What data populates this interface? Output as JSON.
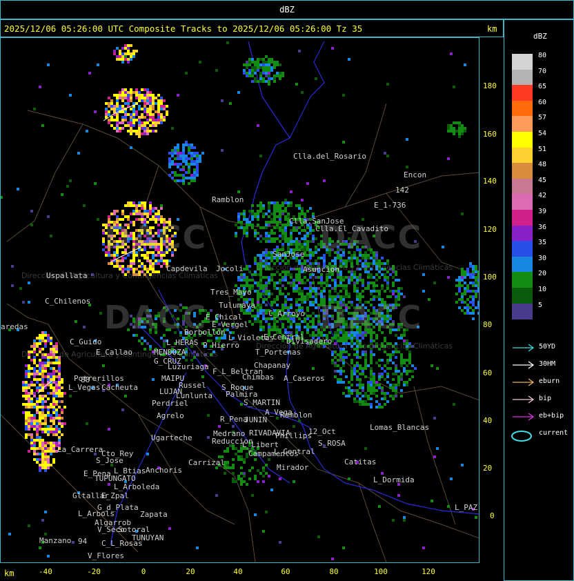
{
  "top_title": "dBZ",
  "main_title": "2025/12/06 05:26:00 UTC Composite Tracks to 2025/12/06 05:26:00 Tz 35",
  "axis_unit_top": "km",
  "axis_unit_bottom": "km",
  "y_ticks": [
    "180",
    "160",
    "140",
    "120",
    "100",
    "80",
    "60",
    "40",
    "20",
    "0"
  ],
  "x_ticks": [
    "-40",
    "-20",
    "0",
    "20",
    "40",
    "60",
    "80",
    "100",
    "120"
  ],
  "watermarks": [
    {
      "text": "DACC",
      "sub": "Dirección de Agricultura y Contingencias Climáticas"
    },
    {
      "text": "DACC",
      "sub": "Dirección de Agricultura y Contingencias Climáticas"
    },
    {
      "text": "DACC",
      "sub": "Dirección de Agricultura y Contingencias Climáticas"
    },
    {
      "text": "DACC",
      "sub": "Dirección de Agricultura y Contingencias Climáticas"
    }
  ],
  "legend": {
    "title": "dBZ",
    "scale": [
      {
        "value": "80",
        "color": "#d4d4d4"
      },
      {
        "value": "70",
        "color": "#b4b4b4"
      },
      {
        "value": "65",
        "color": "#ff3a24"
      },
      {
        "value": "60",
        "color": "#ff6a0a"
      },
      {
        "value": "57",
        "color": "#ff9a5a"
      },
      {
        "value": "54",
        "color": "#ffff00"
      },
      {
        "value": "51",
        "color": "#ffd030"
      },
      {
        "value": "48",
        "color": "#d88c3c"
      },
      {
        "value": "45",
        "color": "#c87890"
      },
      {
        "value": "42",
        "color": "#dc6ab4"
      },
      {
        "value": "39",
        "color": "#d0208c"
      },
      {
        "value": "36",
        "color": "#8a20c8"
      },
      {
        "value": "35",
        "color": "#2850e8"
      },
      {
        "value": "30",
        "color": "#1888e0"
      },
      {
        "value": "20",
        "color": "#148c14"
      },
      {
        "value": "10",
        "color": "#0c5a0c"
      },
      {
        "value": "5",
        "color": "#483c8c"
      }
    ],
    "tracks": [
      {
        "label": "50YD",
        "color": "#40d8d8",
        "kind": "arrow"
      },
      {
        "label": "30HM",
        "color": "#ffffff",
        "kind": "arrow"
      },
      {
        "label": "eburn",
        "color": "#e8b060",
        "kind": "arrow"
      },
      {
        "label": "bip",
        "color": "#f0c8d0",
        "kind": "arrow"
      },
      {
        "label": "eb+bip",
        "color": "#e030e0",
        "kind": "arrow"
      },
      {
        "label": "current",
        "color": "#40e0e8",
        "kind": "ellipse"
      }
    ]
  },
  "places": [
    "Clla.del_Rosario",
    "Encon",
    "Ramblon",
    "E_1-736",
    "142",
    "Clla.SanJose",
    "Clla.El_Cavadito",
    "Uspallata",
    "Capdevila",
    "Jocoli",
    "SanJose",
    "Asuncion",
    "C_Chilenos",
    "Tres_Mayo",
    "Jocoli",
    "Tulumaya",
    "E_Chical",
    "E_Vergel",
    "Borbollon",
    "L_Violetas",
    "E_Central",
    "C_Arroyo",
    "Divisadero",
    "T_Portenas",
    "C_Guido",
    "E_Callao",
    "L_HERAS",
    "P_Hierro",
    "MENDOZA",
    "G_CRUZ",
    "Luzuriaga",
    "F_L_Beltran",
    "Chimbas",
    "Chapanay",
    "A_Caseros",
    "Potrerillos",
    "L_Vegas",
    "Cacheuta",
    "MAIPU",
    "Russel",
    "LUJAN",
    "Lunlunta",
    "S_Roque",
    "Palmira",
    "S_MARTIN",
    "Perdriel",
    "A_Vega",
    "Ramblon",
    "Agrelo",
    "R_Pena",
    "JUNIN",
    "Ugarteche",
    "Medrano",
    "Reduccion",
    "RIVADAVIA",
    "Phillips",
    "12_Oct",
    "S_ROSA",
    "Lomas_Blancas",
    "L_Libert",
    "L_Central",
    "La_Carrera",
    "Cto_Rey",
    "S_Jose",
    "Carrizal",
    "Campamentos",
    "Catitas",
    "E_Pena",
    "L_Btias",
    "Anchoris",
    "TUPUNGATO",
    "Mirador",
    "L_Dormida",
    "E_Zpal",
    "L_Arboleda",
    "Gltallar",
    "G_d_Plata",
    "L_Arbols",
    "Algarrob",
    "Zapata",
    "L_PAZ",
    "V_Seco",
    "Sotoral",
    "TUNUYAN",
    "Manzano",
    "C_L_Rosas",
    "V_Flores",
    "aredas",
    "88",
    "94",
    "Calle_Lar"
  ]
}
